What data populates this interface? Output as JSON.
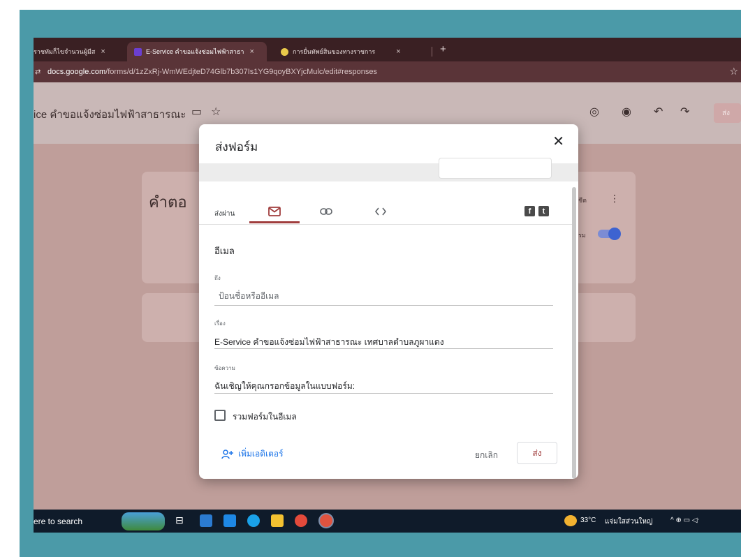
{
  "browser": {
    "tabs": [
      {
        "label": "ราชทัมก็ไขจำนวนผู้มีส",
        "close": "×",
        "active": false
      },
      {
        "label": "E-Service คำขอแจ้งซ่อมไฟฟ้าสาธา",
        "close": "×",
        "active": true
      },
      {
        "label": "การยื่นทัพย์สินของทางราชการ",
        "close": "×",
        "active": false
      }
    ],
    "new_tab": "+",
    "url_main": "docs.google.com",
    "url_rest": "/forms/d/1zZxRj-WmWEdjteD74Glb7b307Is1YG9qoyBXYjcMulc/edit#responses"
  },
  "forms_header": {
    "title": "ice คำขอแจ้งซ่อมไฟฟ้าสาธารณะ",
    "send_label": "ส่ง"
  },
  "background": {
    "card_title": "คำตอ",
    "right_text_1": "ชีต",
    "right_text_2": "รม"
  },
  "dialog": {
    "title": "ส่งฟอร์ม",
    "close": "✕",
    "send_via_label": "ส่งผ่าน",
    "email_tab_icon": "email-icon",
    "link_tab_icon": "link-icon",
    "embed_tab_icon": "embed-icon",
    "section_title": "อีเมล",
    "to_label": "ถึง",
    "to_placeholder": "ป้อนชื่อหรืออีเมล",
    "subject_label": "เรื่อง",
    "subject_value": "E-Service คำขอแจ้งซ่อมไฟฟ้าสาธารณะ           เทศบาลตำบลภูผาแดง",
    "message_label": "ข้อความ",
    "message_value": "ฉันเชิญให้คุณกรอกข้อมูลในแบบฟอร์ม:",
    "include_form_label": "รวมฟอร์มในอีเมล",
    "add_collaborators": "เพิ่มเอดิเตอร์",
    "cancel": "ยกเลิก",
    "send": "ส่ง"
  },
  "taskbar": {
    "search_text": "ere to search",
    "weather": "33°C",
    "weather_text": "แจ่มใสส่วนใหญ่",
    "tray_symbols": "^ ⊕ ▭ ◁ᐧ"
  },
  "colors": {
    "frame": "#4b9aa8",
    "accent": "#a03d3d",
    "link_blue": "#1a73e8",
    "toggle": "#3d63d1"
  }
}
